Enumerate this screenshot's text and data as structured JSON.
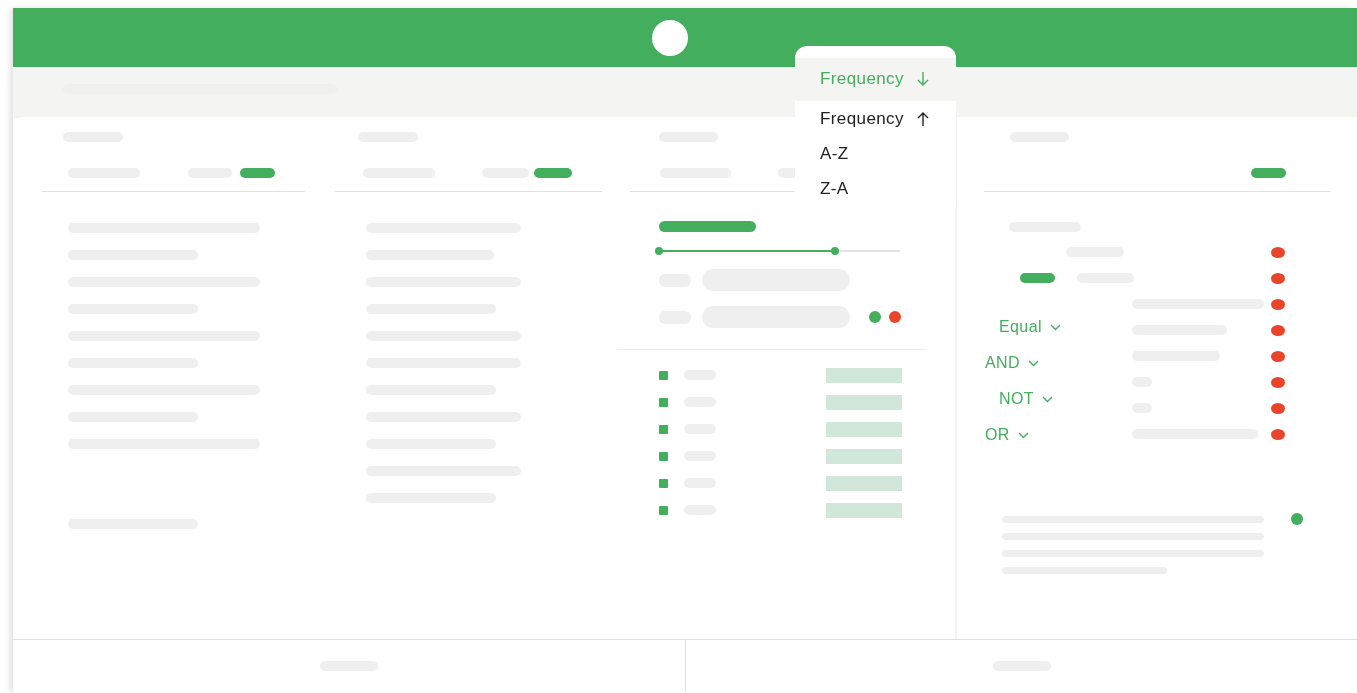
{
  "sort_menu": {
    "items": [
      {
        "label": "Frequency",
        "kind": "descending",
        "selected": true
      },
      {
        "label": "Frequency",
        "kind": "ascending",
        "selected": false
      },
      {
        "label": "A-Z",
        "kind": "plain",
        "selected": false
      },
      {
        "label": "Z-A",
        "kind": "plain",
        "selected": false
      }
    ]
  },
  "range_slider": {
    "level": 0.73
  },
  "operators": [
    {
      "label": "Equal"
    },
    {
      "label": "AND"
    },
    {
      "label": "NOT"
    },
    {
      "label": "OR"
    }
  ]
}
